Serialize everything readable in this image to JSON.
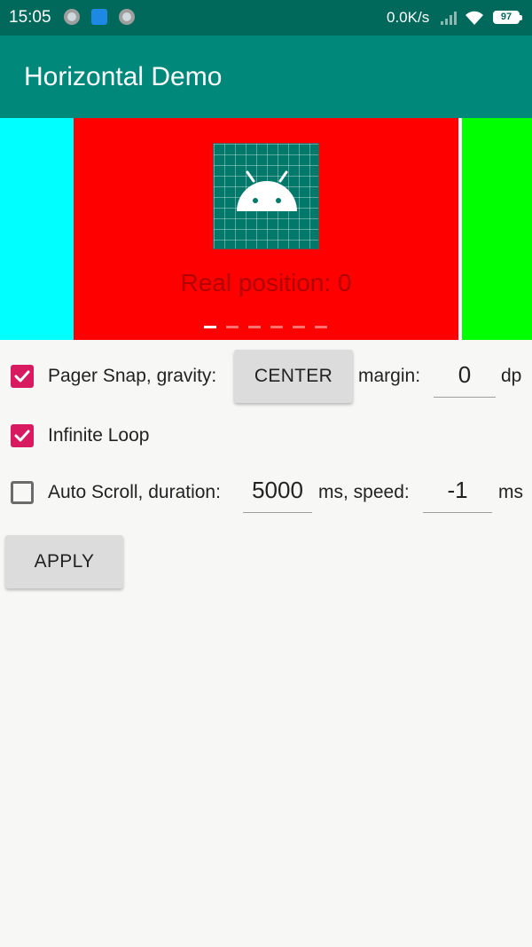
{
  "status_bar": {
    "time": "15:05",
    "network_speed": "0.0K/s",
    "battery_level": "97",
    "icons": [
      "notification-circle-icon",
      "screenshot-app-icon",
      "notification-circle-icon",
      "signal-icon",
      "wifi-icon",
      "battery-icon"
    ]
  },
  "app_bar": {
    "title": "Horizontal Demo"
  },
  "pager": {
    "center_text": "Real position: 0",
    "image_icon": "android-launcher-icon",
    "colors": {
      "left": "#00ffff",
      "center": "#ff0000",
      "right": "#00ff00"
    },
    "indicator_count": 6,
    "active_indicator": 0
  },
  "options": {
    "pager_snap": {
      "checked": true,
      "label": "Pager Snap, gravity:",
      "gravity_button": "CENTER",
      "margin_label": "margin:",
      "margin_value": "0",
      "margin_unit": "dp"
    },
    "infinite_loop": {
      "checked": true,
      "label": "Infinite Loop"
    },
    "auto_scroll": {
      "checked": false,
      "label": "Auto Scroll, duration:",
      "duration_value": "5000",
      "speed_label": "ms, speed:",
      "speed_value": "-1",
      "speed_unit": "ms"
    }
  },
  "apply_button": "APPLY",
  "accent_colors": {
    "primary": "#00897b",
    "primary_dark": "#00695c",
    "checkbox": "#d81b60"
  }
}
